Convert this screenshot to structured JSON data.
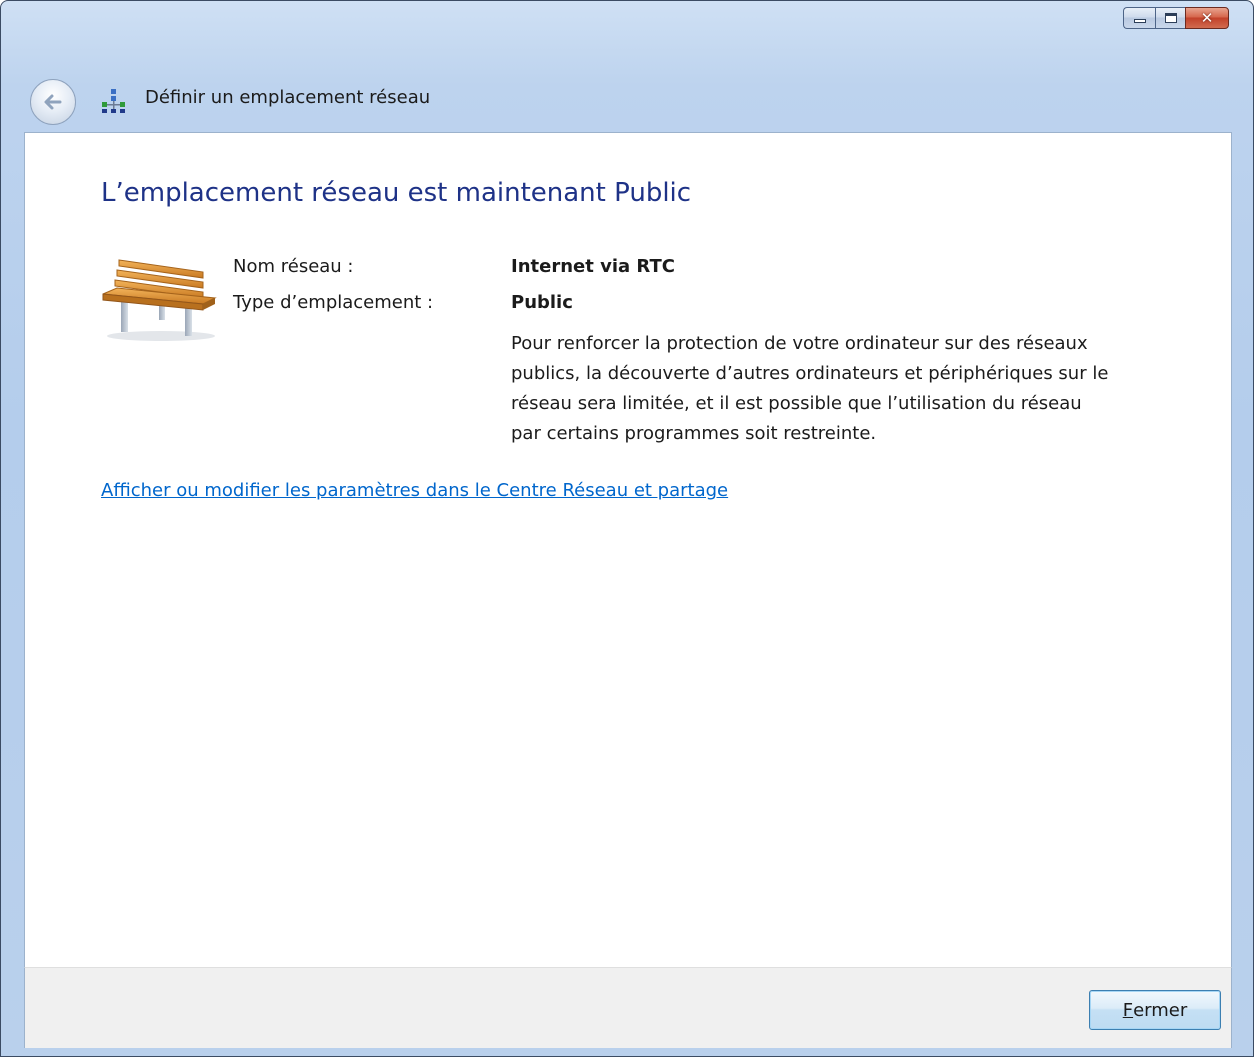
{
  "window": {
    "title": "Définir un emplacement réseau",
    "caption_buttons": {
      "minimize_icon": "minimize-icon",
      "maximize_icon": "maximize-icon",
      "close_icon": "close-icon",
      "close_glyph": "✕"
    }
  },
  "header": {
    "back_icon": "back-arrow-icon",
    "network_icon": "network-icon"
  },
  "main": {
    "heading": "L’emplacement réseau est maintenant Public",
    "icon": "park-bench-icon",
    "fields": [
      {
        "label": "Nom réseau :",
        "value": "Internet via RTC"
      },
      {
        "label": "Type d’emplacement :",
        "value": "Public"
      }
    ],
    "description": "Pour renforcer la protection de votre ordinateur sur des réseaux publics, la découverte d’autres ordinateurs et périphériques sur le réseau sera limitée, et il est possible que l’utilisation du réseau par certains programmes soit restreinte.",
    "link": "Afficher ou modifier les paramètres dans le Centre Réseau et partage"
  },
  "footer": {
    "close_button_mnemonic": "F",
    "close_button_rest": "ermer"
  },
  "colors": {
    "heading": "#1e3287",
    "link": "#0066cc",
    "chrome": "#b9d0ec",
    "footer": "#f0f0f0"
  }
}
